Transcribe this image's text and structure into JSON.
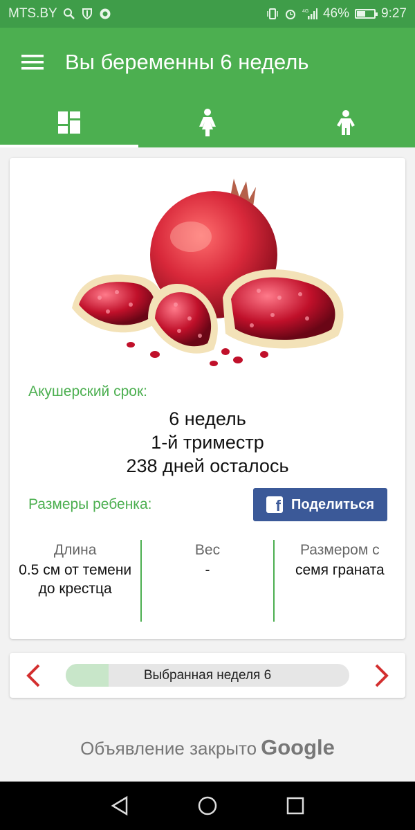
{
  "status_bar": {
    "carrier": "MTS.BY",
    "battery": "46%",
    "time": "9:27",
    "network": "4G"
  },
  "app_bar": {
    "title": "Вы беременны 6 недель",
    "menu_icon": "menu-icon"
  },
  "tabs": [
    {
      "icon": "dashboard-icon",
      "active": true
    },
    {
      "icon": "woman-icon",
      "active": false
    },
    {
      "icon": "child-icon",
      "active": false
    }
  ],
  "card": {
    "fruit_image": "pomegranate",
    "term_label": "Акушерский срок:",
    "weeks": "6 недель",
    "trimester": "1-й триместр",
    "days_left": "238 дней осталось",
    "size_label": "Размеры ребенка:",
    "share_label": "Поделиться",
    "stats": [
      {
        "label": "Длина",
        "value": "0.5 см от темени до крестца"
      },
      {
        "label": "Вес",
        "value": "-"
      },
      {
        "label": "Размером с",
        "value": "семя граната"
      }
    ]
  },
  "week_nav": {
    "label": "Выбранная неделя 6",
    "progress_fraction": 0.15
  },
  "ad": {
    "text": "Объявление закрыто",
    "brand": "Google"
  },
  "colors": {
    "primary": "#4caf50",
    "status_bar": "#3f9d49",
    "facebook": "#3b5998",
    "arrow": "#d32f2f"
  }
}
